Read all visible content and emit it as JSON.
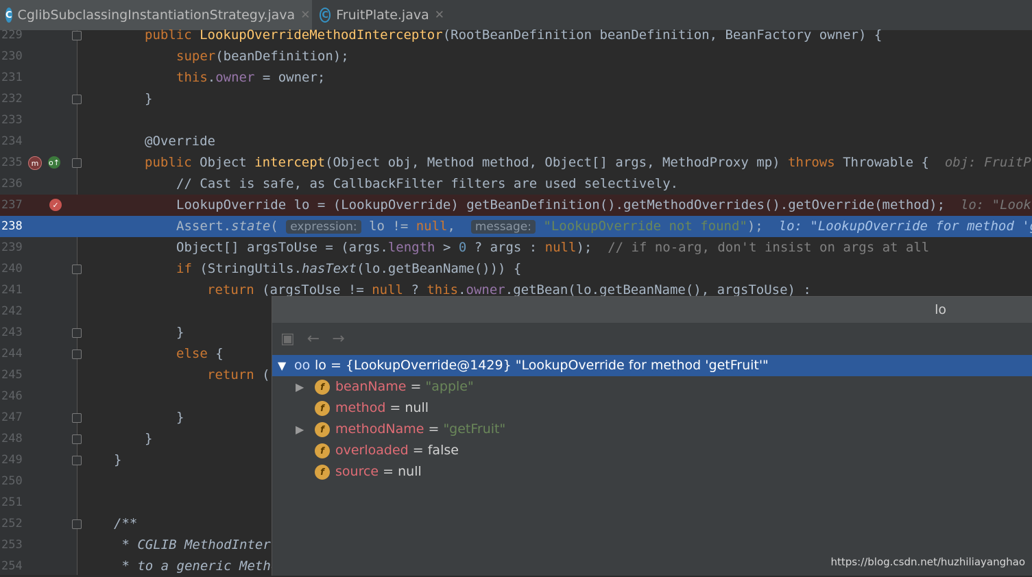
{
  "tabs": [
    {
      "label": "CglibSubclassingInstantiationStrategy.java",
      "icon": "class-icon",
      "active": true
    },
    {
      "label": "FruitPlate.java",
      "icon": "class-icon",
      "active": false
    }
  ],
  "editor": {
    "line_numbers": [
      "229",
      "230",
      "231",
      "232",
      "233",
      "234",
      "235",
      "236",
      "237",
      "238",
      "239",
      "240",
      "241",
      "242",
      "243",
      "244",
      "245",
      "246",
      "247",
      "248",
      "249",
      "250",
      "251",
      "252",
      "253",
      "254"
    ],
    "current_line": "238",
    "breakpoint_line": "237"
  },
  "code": {
    "l229": {
      "kw": "public ",
      "fn": "LookupOverrideMethodInterceptor",
      "rest": "(RootBeanDefinition beanDefinition, BeanFactory owner) {"
    },
    "l230": {
      "kw": "super",
      "rest": "(beanDefinition);"
    },
    "l231": {
      "kw": "this",
      "dot": ".",
      "fd": "owner",
      "rest": " = owner;"
    },
    "l232": {
      "rest": "}"
    },
    "l234": {
      "an": "@Override"
    },
    "l235": {
      "kw": "public ",
      "type": "Object ",
      "fn": "intercept",
      "rest": "(Object obj, Method method, Object[] args, MethodProxy mp) ",
      "kw2": "throws ",
      "rest2": "Throwable { ",
      "hint": "obj: FruitPla"
    },
    "l236": {
      "cm": "// Cast is safe, as CallbackFilter filters are used selectively."
    },
    "l237": {
      "rest": "LookupOverride lo = (LookupOverride) getBeanDefinition().getMethodOverrides().getOverride(method);",
      "hint": "lo: \"Lookup"
    },
    "l238": {
      "a": "Assert.",
      "b": "state",
      "c": "(",
      "chip1": "expression:",
      "d": "lo != ",
      "e": "null",
      "f": ", ",
      "chip2": "message:",
      "g": "\"LookupOverride not found\"",
      "h": ");",
      "hint": "lo: \"LookupOverride for method 'getF"
    },
    "l239": {
      "a": "Object[] argsToUse = (args.",
      "b": "length",
      "c": " > ",
      "d": "0",
      "e": " ? args : ",
      "f": "null",
      "g": ");  ",
      "cm": "// if no-arg, don't insist on args at all"
    },
    "l240": {
      "kw": "if ",
      "a": "(StringUtils.",
      "b": "hasText",
      "c": "(lo.getBeanName())) {"
    },
    "l241": {
      "kw": "return ",
      "a": "(argsToUse != ",
      "b": "null",
      "c": " ? ",
      "d": "this",
      "e": ".",
      "f": "owner",
      "g": ".getBean(lo.getBeanName(), argsToUse) :"
    },
    "l243": {
      "rest": "}"
    },
    "l244": {
      "kw": "else ",
      "rest": "{"
    },
    "l245": {
      "kw": "return ",
      "rest": "("
    },
    "l247": {
      "rest": "}"
    },
    "l248": {
      "rest": "}"
    },
    "l249": {
      "rest": "}"
    },
    "l252": {
      "dc": "/**"
    },
    "l253": {
      "dc": " * CGLIB MethodInterc"
    },
    "l254": {
      "dc": " * to a generic Metho"
    }
  },
  "popup": {
    "title": "lo",
    "toolbar": [
      "navigate-icon",
      "back-arrow-icon",
      "forward-arrow-icon"
    ],
    "root": {
      "label": "lo = {LookupOverride@1429} \"LookupOverride for method 'getFruit'\"",
      "icon": "watch-icon"
    },
    "fields": [
      {
        "name": "beanName",
        "eq": " = ",
        "value": "\"apple\"",
        "is_string": true,
        "expandable": true
      },
      {
        "name": "method",
        "eq": " = ",
        "value": "null",
        "is_string": false,
        "expandable": false
      },
      {
        "name": "methodName",
        "eq": " = ",
        "value": "\"getFruit\"",
        "is_string": true,
        "expandable": true
      },
      {
        "name": "overloaded",
        "eq": " = ",
        "value": "false",
        "is_string": false,
        "expandable": false
      },
      {
        "name": "source",
        "eq": " = ",
        "value": "null",
        "is_string": false,
        "expandable": false
      }
    ],
    "field_icon_letter": "f"
  },
  "watermark": "https://blog.csdn.net/huzhiliayanghao",
  "colors": {
    "selection": "#2d5a9b",
    "keyword": "#cc7832",
    "method": "#ffc66d",
    "string": "#6a8759",
    "field": "#9876aa"
  }
}
